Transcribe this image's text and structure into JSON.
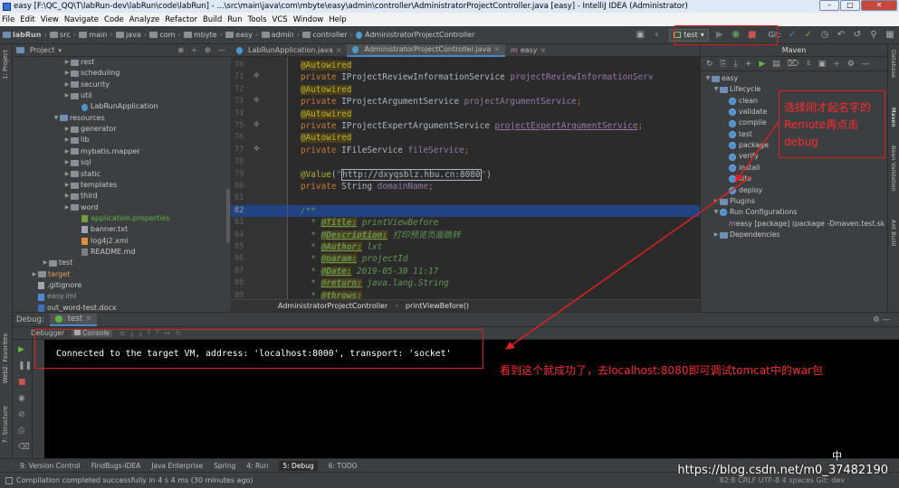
{
  "window": {
    "title": "easy [F:\\QC_QQ\\T\\labRun-dev\\labRun\\code\\labRun] - ...\\src\\main\\java\\com\\mbyte\\easy\\admin\\controller\\AdministratorProjectController.java [easy] - IntelliJ IDEA (Administrator)",
    "min_label": "–",
    "max_label": "□",
    "close_label": "✕"
  },
  "menubar": [
    "File",
    "Edit",
    "View",
    "Navigate",
    "Code",
    "Analyze",
    "Refactor",
    "Build",
    "Run",
    "Tools",
    "VCS",
    "Window",
    "Help"
  ],
  "breadcrumbs": [
    "labRun",
    "src",
    "main",
    "java",
    "com",
    "mbyte",
    "easy",
    "admin",
    "controller",
    "AdministratorProjectController"
  ],
  "toolbar": {
    "run_config": "test",
    "git_label": "Git:"
  },
  "project_panel": {
    "title": "Project",
    "items": [
      {
        "label": "rest",
        "type": "folder",
        "indent": 4,
        "arrow": "▶"
      },
      {
        "label": "scheduling",
        "type": "folder",
        "indent": 4,
        "arrow": "▶"
      },
      {
        "label": "security",
        "type": "folder",
        "indent": 4,
        "arrow": "▶"
      },
      {
        "label": "util",
        "type": "folder",
        "indent": 4,
        "arrow": "▶"
      },
      {
        "label": "LabRunApplication",
        "type": "java",
        "indent": 5,
        "arrow": ""
      },
      {
        "label": "resources",
        "type": "folder",
        "indent": 3,
        "arrow": "▼"
      },
      {
        "label": "generator",
        "type": "folder",
        "indent": 4,
        "arrow": "▶"
      },
      {
        "label": "lib",
        "type": "folder",
        "indent": 4,
        "arrow": "▶"
      },
      {
        "label": "mybatis.mapper",
        "type": "folder",
        "indent": 4,
        "arrow": "▶"
      },
      {
        "label": "sql",
        "type": "folder",
        "indent": 4,
        "arrow": "▶"
      },
      {
        "label": "static",
        "type": "folder",
        "indent": 4,
        "arrow": "▶"
      },
      {
        "label": "templates",
        "type": "folder",
        "indent": 4,
        "arrow": "▶"
      },
      {
        "label": "third",
        "type": "folder",
        "indent": 4,
        "arrow": "▶"
      },
      {
        "label": "word",
        "type": "folder",
        "indent": 4,
        "arrow": "▶"
      },
      {
        "label": "application.properties",
        "type": "prop",
        "indent": 5,
        "arrow": "",
        "color": "green"
      },
      {
        "label": "banner.txt",
        "type": "txt",
        "indent": 5,
        "arrow": ""
      },
      {
        "label": "log4j2.xml",
        "type": "xml",
        "indent": 5,
        "arrow": ""
      },
      {
        "label": "README.md",
        "type": "md",
        "indent": 5,
        "arrow": ""
      },
      {
        "label": "test",
        "type": "folder",
        "indent": 2,
        "arrow": "▶"
      },
      {
        "label": "target",
        "type": "folder",
        "indent": 1,
        "arrow": "▶",
        "color": "orange"
      },
      {
        "label": ".gitignore",
        "type": "txt",
        "indent": 1,
        "arrow": ""
      },
      {
        "label": "easy.iml",
        "type": "iml",
        "indent": 1,
        "arrow": "",
        "color": "grey"
      },
      {
        "label": "out_word-test.docx",
        "type": "docx",
        "indent": 1,
        "arrow": ""
      }
    ]
  },
  "editor": {
    "tabs": [
      {
        "label": "LabRunApplication.java",
        "active": false
      },
      {
        "label": "AdministratorProjectController.java",
        "active": true
      },
      {
        "label": "easy",
        "active": false
      }
    ],
    "line_numbers": [
      "70",
      "71",
      "72",
      "73",
      "74",
      "75",
      "76",
      "77",
      "78",
      "79",
      "80",
      "81",
      "82",
      "83",
      "84",
      "85",
      "86",
      "87",
      "88",
      "89"
    ],
    "selected_index": 12,
    "code_breadcrumb": [
      "AdministratorProjectController",
      "printViewBefore()"
    ]
  },
  "maven": {
    "title": "Maven",
    "items": [
      {
        "label": "easy",
        "indent": 0,
        "arrow": "▼",
        "icon": "module"
      },
      {
        "label": "Lifecycle",
        "indent": 1,
        "arrow": "▼",
        "icon": "folder"
      },
      {
        "label": "clean",
        "indent": 3,
        "arrow": "",
        "icon": "gear"
      },
      {
        "label": "validate",
        "indent": 3,
        "arrow": "",
        "icon": "gear"
      },
      {
        "label": "compile",
        "indent": 3,
        "arrow": "",
        "icon": "gear"
      },
      {
        "label": "test",
        "indent": 3,
        "arrow": "",
        "icon": "gear"
      },
      {
        "label": "package",
        "indent": 3,
        "arrow": "",
        "icon": "gear"
      },
      {
        "label": "verify",
        "indent": 3,
        "arrow": "",
        "icon": "gear"
      },
      {
        "label": "install",
        "indent": 3,
        "arrow": "",
        "icon": "gear"
      },
      {
        "label": "site",
        "indent": 3,
        "arrow": "",
        "icon": "gear"
      },
      {
        "label": "deploy",
        "indent": 3,
        "arrow": "",
        "icon": "gear"
      },
      {
        "label": "Plugins",
        "indent": 1,
        "arrow": "▶",
        "icon": "folder"
      },
      {
        "label": "Run Configurations",
        "indent": 1,
        "arrow": "▼",
        "icon": "gear"
      },
      {
        "label": "easy [package] (package -Dmaven.test.sk",
        "indent": 3,
        "arrow": "",
        "icon": "m"
      },
      {
        "label": "Dependencies",
        "indent": 1,
        "arrow": "▶",
        "icon": "folder"
      }
    ]
  },
  "right_strip": [
    "Database",
    "Maven",
    "Bean Validation",
    "Ant Build"
  ],
  "left_strip": [
    "1: Project",
    "2: Favorites",
    "Web",
    "7: Structure"
  ],
  "debug": {
    "title": "Debug:",
    "config": "test",
    "tabs": [
      "Debugger",
      "Console"
    ],
    "console_line": "Connected to the target VM, address: 'localhost:8000', transport: 'socket'"
  },
  "bottom_tabs": [
    "9: Version Control",
    "FindBugs-IDEA",
    "Java Enterprise",
    "Spring",
    "4: Run",
    "5: Debug",
    "6: TODO"
  ],
  "status": {
    "message": "Compilation completed successfully in 4 s 4 ms (30 minutes ago)",
    "right": "82:8  CRLF  UTF-8  4 spaces  Git: dev"
  },
  "annotations": {
    "top_right": [
      "选择刚才起名字的",
      "Remote再点击",
      "debug"
    ],
    "bottom": "看到这个就成功了，去localhost:8080即可调试tomcat中的war包",
    "color": "#ff2a2a"
  },
  "ime_glyph": "中",
  "watermark": "https://blog.csdn.net/m0_37482190"
}
